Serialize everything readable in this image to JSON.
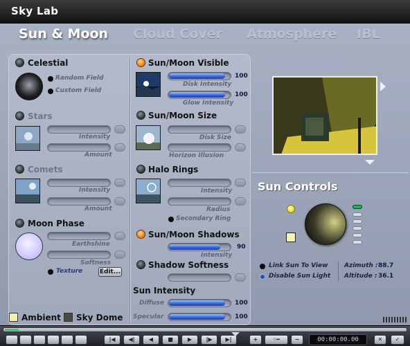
{
  "window": {
    "title": "Sky Lab"
  },
  "tabs": [
    {
      "label": "Sun & Moon",
      "active": true
    },
    {
      "label": "Cloud Cover"
    },
    {
      "label": "Atmosphere"
    },
    {
      "label": "IBL"
    }
  ],
  "celestial": {
    "label": "Celestial",
    "random_field": "Random Field",
    "custom_field": "Custom Field"
  },
  "stars": {
    "label": "Stars",
    "intensity": "Intensity",
    "amount": "Amount"
  },
  "comets": {
    "label": "Comets",
    "intensity": "Intensity",
    "amount": "Amount"
  },
  "moon_phase": {
    "label": "Moon Phase",
    "earthshine": "Earthshine",
    "softness": "Softness",
    "texture": "Texture",
    "edit": "Edit..."
  },
  "sun_moon_visible": {
    "label": "Sun/Moon Visible",
    "disk_intensity": "Disk Intensity",
    "disk_value": "100",
    "glow_intensity": "Glow Intensity",
    "glow_value": "100",
    "disk_fraction": 0.9,
    "glow_fraction": 0.9
  },
  "sun_moon_size": {
    "label": "Sun/Moon Size",
    "disk_size": "Disk Size",
    "horizon_illusion": "Horizon Illusion"
  },
  "halo_rings": {
    "label": "Halo Rings",
    "intensity": "Intensity",
    "radius": "Radius",
    "secondary_ring": "Secondary Ring"
  },
  "sun_moon_shadows": {
    "label": "Sun/Moon Shadows",
    "intensity": "Intensity",
    "value": "90",
    "fraction": 0.82
  },
  "shadow_softness": {
    "label": "Shadow Softness"
  },
  "sun_intensity": {
    "label": "Sun Intensity",
    "diffuse": "Diffuse",
    "diffuse_value": "100",
    "specular": "Specular",
    "specular_value": "100",
    "diffuse_fraction": 0.9,
    "specular_fraction": 0.9
  },
  "sun_controls": {
    "title": "Sun Controls",
    "link_sun": "Link Sun To View",
    "disable_sun": "Disable Sun Light",
    "azimuth_label": "Azimuth :",
    "azimuth_value": "88.7",
    "altitude_label": "Altitude :",
    "altitude_value": "36.1"
  },
  "footer": {
    "ambient": "Ambient",
    "sky_dome": "Sky Dome",
    "ambient_color": "#f3efb0",
    "sky_dome_color": "#4a4a44"
  },
  "timeline": {
    "timecode": "00:00:00.00"
  },
  "colors": {
    "accent_blue": "#3a66d8",
    "led_on": "#e87b10",
    "bg": "#9aa3b7"
  }
}
